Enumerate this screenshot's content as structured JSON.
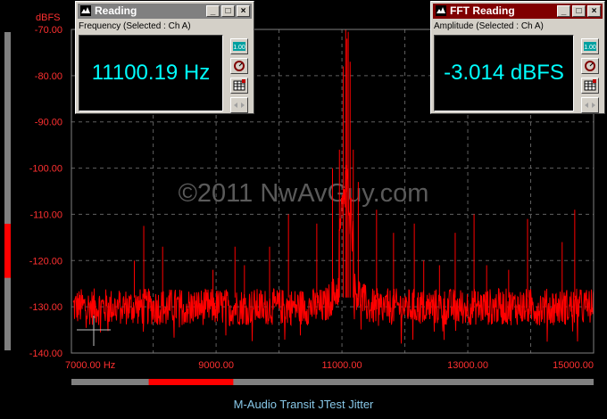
{
  "chart_data": {
    "type": "line",
    "ylabel": "dBFS",
    "xlabel": "",
    "xlim": [
      6700,
      15000
    ],
    "ylim": [
      -140,
      -70
    ],
    "x_ticks": [
      {
        "value": 7000,
        "label": "7000.00 Hz"
      },
      {
        "value": 9000,
        "label": "9000.00"
      },
      {
        "value": 11000,
        "label": "11000.00"
      },
      {
        "value": 13000,
        "label": "13000.00"
      },
      {
        "value": 15000,
        "label": "15000.00"
      }
    ],
    "y_ticks": [
      {
        "value": -70,
        "label": "-70.00"
      },
      {
        "value": -80,
        "label": "-80.00"
      },
      {
        "value": -90,
        "label": "-90.00"
      },
      {
        "value": -100,
        "label": "-100.00"
      },
      {
        "value": -110,
        "label": "-110.00"
      },
      {
        "value": -120,
        "label": "-120.00"
      },
      {
        "value": -130,
        "label": "-130.00"
      },
      {
        "value": -140,
        "label": "-140.00"
      }
    ],
    "grid": true,
    "noise_floor_dbfs": -130,
    "series": [
      {
        "color": "#ff0000",
        "peaks": [
          {
            "x": 7700,
            "y": -120
          },
          {
            "x": 7850,
            "y": -112.5
          },
          {
            "x": 8150,
            "y": -117
          },
          {
            "x": 8950,
            "y": -122
          },
          {
            "x": 9300,
            "y": -117
          },
          {
            "x": 9450,
            "y": -121
          },
          {
            "x": 9850,
            "y": -117
          },
          {
            "x": 10150,
            "y": -110
          },
          {
            "x": 10600,
            "y": -112
          },
          {
            "x": 10850,
            "y": -100
          },
          {
            "x": 10960,
            "y": -96
          },
          {
            "x": 11020,
            "y": -78
          },
          {
            "x": 11060,
            "y": -70
          },
          {
            "x": 11080,
            "y": -72
          },
          {
            "x": 11100,
            "y": -70.5
          },
          {
            "x": 11130,
            "y": -77
          },
          {
            "x": 11180,
            "y": -96
          },
          {
            "x": 11260,
            "y": -103
          },
          {
            "x": 11550,
            "y": -109
          },
          {
            "x": 11820,
            "y": -114
          },
          {
            "x": 12150,
            "y": -112
          },
          {
            "x": 12300,
            "y": -120
          },
          {
            "x": 12550,
            "y": -121
          },
          {
            "x": 12800,
            "y": -114
          },
          {
            "x": 13100,
            "y": -110
          },
          {
            "x": 13300,
            "y": -121
          },
          {
            "x": 13650,
            "y": -122
          },
          {
            "x": 13950,
            "y": -111
          },
          {
            "x": 14500,
            "y": -116
          },
          {
            "x": 14700,
            "y": -109
          }
        ]
      }
    ]
  },
  "watermark": "©2011 NwAvGuy.com",
  "caption": "M-Audio Transit JTest Jitter",
  "colors": {
    "background": "#000000",
    "grid": "#606060",
    "trace": "#ff0000",
    "axis_text": "#ff3030",
    "readout_text": "#00ffff",
    "caption": "#88c8e8"
  },
  "left_level_meter": {
    "fraction": 0.17
  },
  "x_scrollbar": {
    "thumb_start": 0.148,
    "thumb_end": 0.31
  },
  "windows": {
    "reading": {
      "title": "Reading",
      "label": "Frequency (Selected : Ch A)",
      "value": "11100.19 Hz",
      "scale_button": "1.00",
      "min_glyph": "_",
      "max_glyph": "□",
      "close_glyph": "×"
    },
    "fft": {
      "title": "FFT Reading",
      "label": "Amplitude (Selected : Ch A)",
      "value": "-3.014 dBFS",
      "scale_button": "1.00",
      "min_glyph": "_",
      "max_glyph": "□",
      "close_glyph": "×"
    }
  }
}
